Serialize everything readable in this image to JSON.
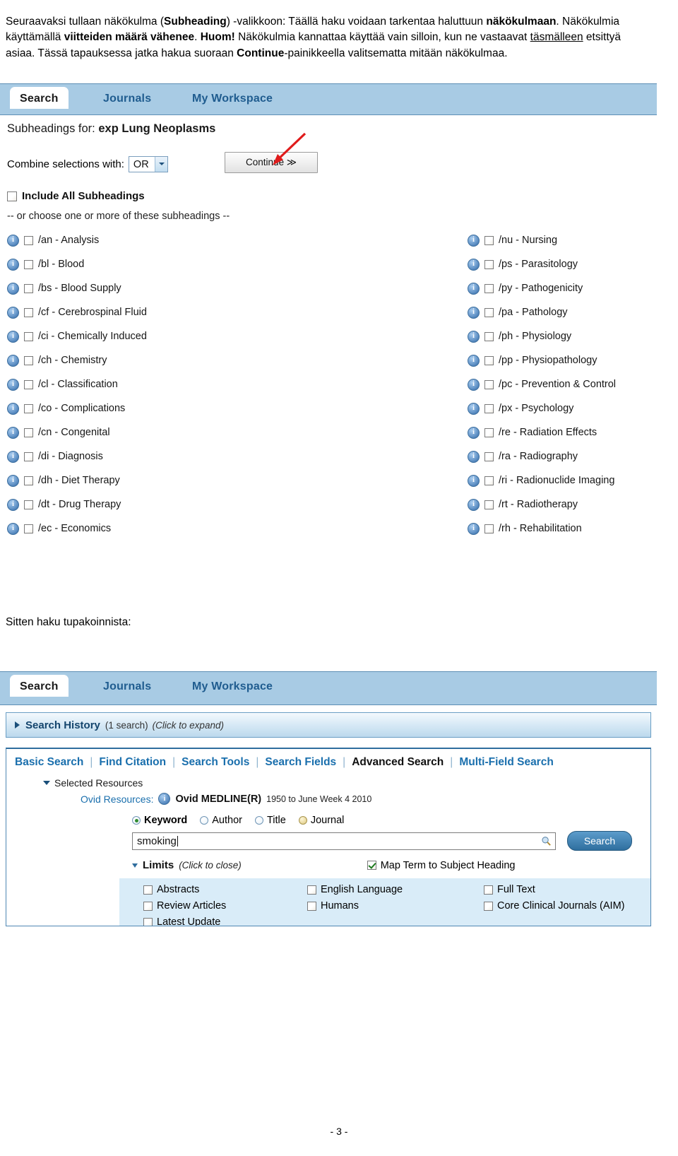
{
  "intro": {
    "line1_a": "Seuraavaksi tullaan näkökulma (",
    "line1_b": "Subheading",
    "line1_c": ") -valikkoon: Täällä haku voidaan tarkentaa haluttuun ",
    "line1_d": "näkökulmaan",
    "line1_e": ". Näkökulmia käyttämällä ",
    "line1_f": "viitteiden määrä vähenee",
    "line1_g": ". ",
    "line1_h": "Huom!",
    "line1_i": " Näkökulmia kannattaa käyttää vain silloin, kun ne vastaavat ",
    "line1_j": "täsmälleen",
    "line1_k": " etsittyä asiaa. Tässä tapauksessa jatka hakua suoraan ",
    "line1_l": "Continue",
    "line1_m": "-painikkeella valitsematta mitään näkökulmaa."
  },
  "mid_text": "Sitten haku tupakoinnista:",
  "footer": "- 3 -",
  "colors": {
    "tab_bar": "#a8cbe4",
    "link_blue": "#1a6fad",
    "panel_border": "#4f87b3",
    "limits_bg": "#d9ecf8",
    "arrow_red": "#e01b1b"
  },
  "shot1": {
    "tabs": [
      {
        "label": "Search",
        "active": true
      },
      {
        "label": "Journals",
        "active": false
      },
      {
        "label": "My Workspace",
        "active": false
      }
    ],
    "title_label": "Subheadings for:",
    "title_term": "exp Lung Neoplasms",
    "combine_label": "Combine selections with:",
    "combine_value": "OR",
    "continue_label": "Continue ≫",
    "include_all_label": "Include All Subheadings",
    "choose_note": "-- or choose one or more of these subheadings --",
    "left_column": [
      {
        "code": "/an",
        "name": "Analysis",
        "checked": false
      },
      {
        "code": "/bl",
        "name": "Blood",
        "checked": false
      },
      {
        "code": "/bs",
        "name": "Blood Supply",
        "checked": false
      },
      {
        "code": "/cf",
        "name": "Cerebrospinal Fluid",
        "checked": false
      },
      {
        "code": "/ci",
        "name": "Chemically Induced",
        "checked": false
      },
      {
        "code": "/ch",
        "name": "Chemistry",
        "checked": false
      },
      {
        "code": "/cl",
        "name": "Classification",
        "checked": false
      },
      {
        "code": "/co",
        "name": "Complications",
        "checked": false
      },
      {
        "code": "/cn",
        "name": "Congenital",
        "checked": false
      },
      {
        "code": "/di",
        "name": "Diagnosis",
        "checked": false
      },
      {
        "code": "/dh",
        "name": "Diet Therapy",
        "checked": false
      },
      {
        "code": "/dt",
        "name": "Drug Therapy",
        "checked": false
      },
      {
        "code": "/ec",
        "name": "Economics",
        "checked": false
      }
    ],
    "right_column": [
      {
        "code": "/nu",
        "name": "Nursing",
        "checked": false
      },
      {
        "code": "/ps",
        "name": "Parasitology",
        "checked": false
      },
      {
        "code": "/py",
        "name": "Pathogenicity",
        "checked": false
      },
      {
        "code": "/pa",
        "name": "Pathology",
        "checked": false
      },
      {
        "code": "/ph",
        "name": "Physiology",
        "checked": false
      },
      {
        "code": "/pp",
        "name": "Physiopathology",
        "checked": false
      },
      {
        "code": "/pc",
        "name": "Prevention & Control",
        "checked": false
      },
      {
        "code": "/px",
        "name": "Psychology",
        "checked": false
      },
      {
        "code": "/re",
        "name": "Radiation Effects",
        "checked": false
      },
      {
        "code": "/ra",
        "name": "Radiography",
        "checked": false
      },
      {
        "code": "/ri",
        "name": "Radionuclide Imaging",
        "checked": false
      },
      {
        "code": "/rt",
        "name": "Radiotherapy",
        "checked": false
      },
      {
        "code": "/rh",
        "name": "Rehabilitation",
        "checked": false
      }
    ]
  },
  "shot2": {
    "tabs": [
      {
        "label": "Search",
        "active": true
      },
      {
        "label": "Journals",
        "active": false
      },
      {
        "label": "My Workspace",
        "active": false
      }
    ],
    "history": {
      "title": "Search History",
      "count": "(1 search)",
      "hint": "(Click to expand)"
    },
    "modes": [
      {
        "label": "Basic Search",
        "current": false
      },
      {
        "label": "Find Citation",
        "current": false
      },
      {
        "label": "Search Tools",
        "current": false
      },
      {
        "label": "Search Fields",
        "current": false
      },
      {
        "label": "Advanced Search",
        "current": true
      },
      {
        "label": "Multi-Field Search",
        "current": false
      }
    ],
    "selected_resources_label": "Selected Resources",
    "ovid_resources_label": "Ovid Resources:",
    "database_name": "Ovid MEDLINE(R)",
    "database_range": "1950 to June Week 4 2010",
    "search_modes": [
      {
        "label": "Keyword",
        "selected": true,
        "style": "blue"
      },
      {
        "label": "Author",
        "selected": false,
        "style": "blue"
      },
      {
        "label": "Title",
        "selected": false,
        "style": "blue"
      },
      {
        "label": "Journal",
        "selected": false,
        "style": "gold"
      }
    ],
    "query_value": "smoking",
    "search_button": "Search",
    "limits": {
      "title": "Limits",
      "hint": "(Click to close)",
      "map_term_label": "Map Term to Subject Heading",
      "map_term_checked": true,
      "options": [
        {
          "label": "Abstracts",
          "checked": false
        },
        {
          "label": "English Language",
          "checked": false
        },
        {
          "label": "Full Text",
          "checked": false
        },
        {
          "label": "Review Articles",
          "checked": false
        },
        {
          "label": "Humans",
          "checked": false
        },
        {
          "label": "Core Clinical Journals (AIM)",
          "checked": false
        },
        {
          "label": "Latest Update",
          "checked": false
        },
        {
          "label": "",
          "checked": false
        },
        {
          "label": "",
          "checked": false
        }
      ]
    }
  }
}
